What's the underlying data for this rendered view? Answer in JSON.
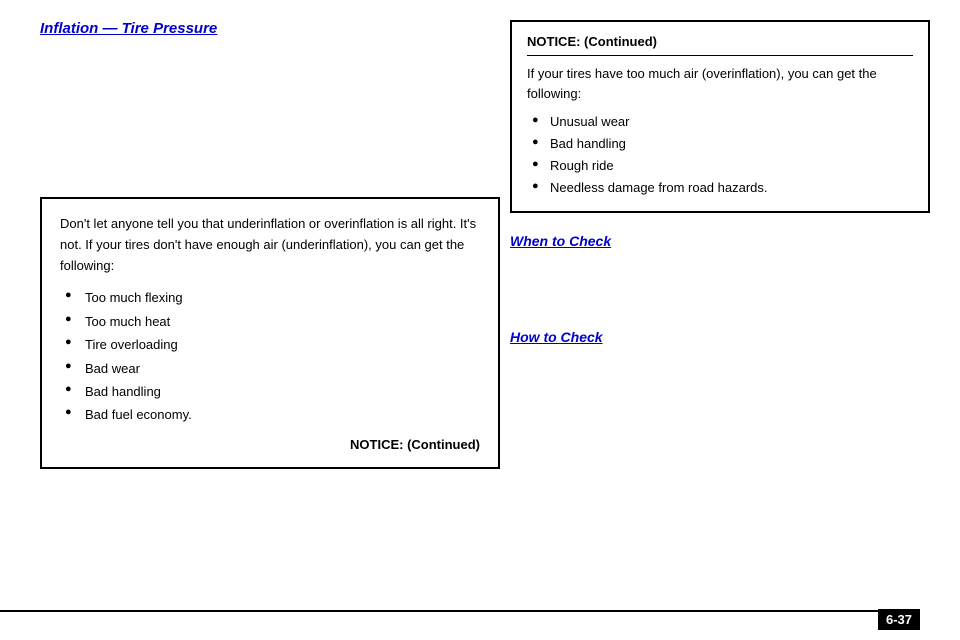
{
  "page": {
    "title": "Inflation — Tire Pressure",
    "page_number": "6-37"
  },
  "left_column": {
    "section_title": "Inflation — Tire Pressure",
    "notice_box": {
      "intro_text": "Don't let anyone tell you that underinflation or overinflation is all right. It's not. If your tires don't have enough air (underinflation), you can get the following:",
      "items": [
        "Too much flexing",
        "Too much heat",
        "Tire overloading",
        "Bad wear",
        "Bad handling",
        "Bad fuel economy."
      ],
      "continued_label": "NOTICE: (Continued)"
    }
  },
  "right_column": {
    "notice_continued_box": {
      "title": "NOTICE: (Continued)",
      "intro_text": "If your tires have too much air (overinflation), you can get the following:",
      "items": [
        "Unusual wear",
        "Bad handling",
        "Rough ride",
        "Needless damage from road hazards."
      ]
    },
    "when_to_check_title": "When to Check",
    "how_to_check_title": "How to Check"
  },
  "icons": {
    "bullet": "●"
  }
}
